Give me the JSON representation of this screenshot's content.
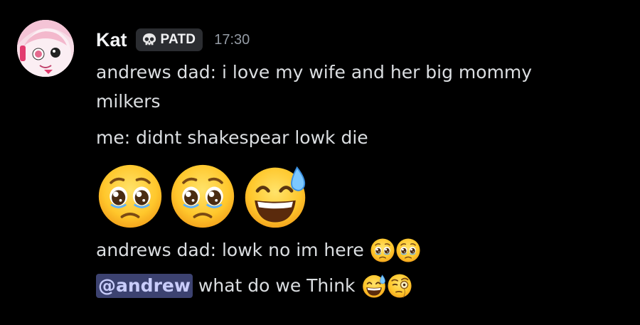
{
  "message": {
    "author": "Kat",
    "tag": {
      "icon": "skull-icon",
      "label": "PATD"
    },
    "timestamp": "17:30",
    "lines": {
      "line1a": "andrews dad: i love my wife and her big mommy",
      "line1b": "milkers",
      "line2": "me: didnt shakespear lowk die",
      "jumbo_emoji": [
        "pleading-face-icon",
        "pleading-face-icon",
        "grinning-sweat-face-icon"
      ],
      "line3": "andrews dad: lowk no im here",
      "line3_emoji": [
        "pleading-face-icon",
        "pleading-face-icon"
      ],
      "mention": "@andrew",
      "line4": " what do we Think",
      "line4_emoji": [
        "grinning-sweat-face-icon",
        "monocle-face-icon"
      ]
    }
  },
  "colors": {
    "background": "#000000",
    "username": "#f2f3f5",
    "text": "#dbdee1",
    "timestamp": "#949ba4",
    "mention_bg": "#3c4270",
    "mention_text": "#c9cdfb"
  }
}
